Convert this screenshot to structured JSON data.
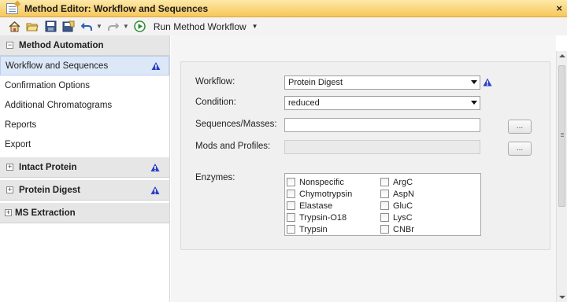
{
  "window": {
    "title": "Method Editor: Workflow and Sequences",
    "close_label": "×"
  },
  "toolbar": {
    "icons": [
      "home-icon",
      "open-folder-icon",
      "save-icon",
      "save-as-icon",
      "undo-icon",
      "redo-icon",
      "run-icon"
    ],
    "run_label": "Run Method Workflow"
  },
  "sidebar": {
    "groups": [
      {
        "label": "Method Automation",
        "expander": "−",
        "warning": false
      },
      {
        "label": "Intact Protein",
        "expander": "+",
        "warning": true
      },
      {
        "label": "Protein Digest",
        "expander": "+",
        "warning": true
      },
      {
        "label": "MS Extraction",
        "expander": "+",
        "warning": false
      }
    ],
    "items": [
      {
        "label": "Workflow and Sequences",
        "selected": true,
        "warning": true
      },
      {
        "label": "Confirmation Options"
      },
      {
        "label": "Additional Chromatograms"
      },
      {
        "label": "Reports"
      },
      {
        "label": "Export"
      }
    ]
  },
  "form": {
    "workflow_label": "Workflow:",
    "workflow_value": "Protein Digest",
    "condition_label": "Condition:",
    "condition_value": "reduced",
    "sequences_label": "Sequences/Masses:",
    "sequences_value": "",
    "mods_label": "Mods and Profiles:",
    "mods_value": "",
    "browse_label": "...",
    "enzymes_label": "Enzymes:",
    "enzymes_left": [
      "Nonspecific",
      "Chymotrypsin",
      "Elastase",
      "Trypsin-O18",
      "Trypsin"
    ],
    "enzymes_right": [
      "ArgC",
      "AspN",
      "GluC",
      "LysC",
      "CNBr"
    ]
  },
  "colors": {
    "title_bar": "#f7c75a",
    "selection": "#dce8f8",
    "warning": "#2a3fc4"
  }
}
